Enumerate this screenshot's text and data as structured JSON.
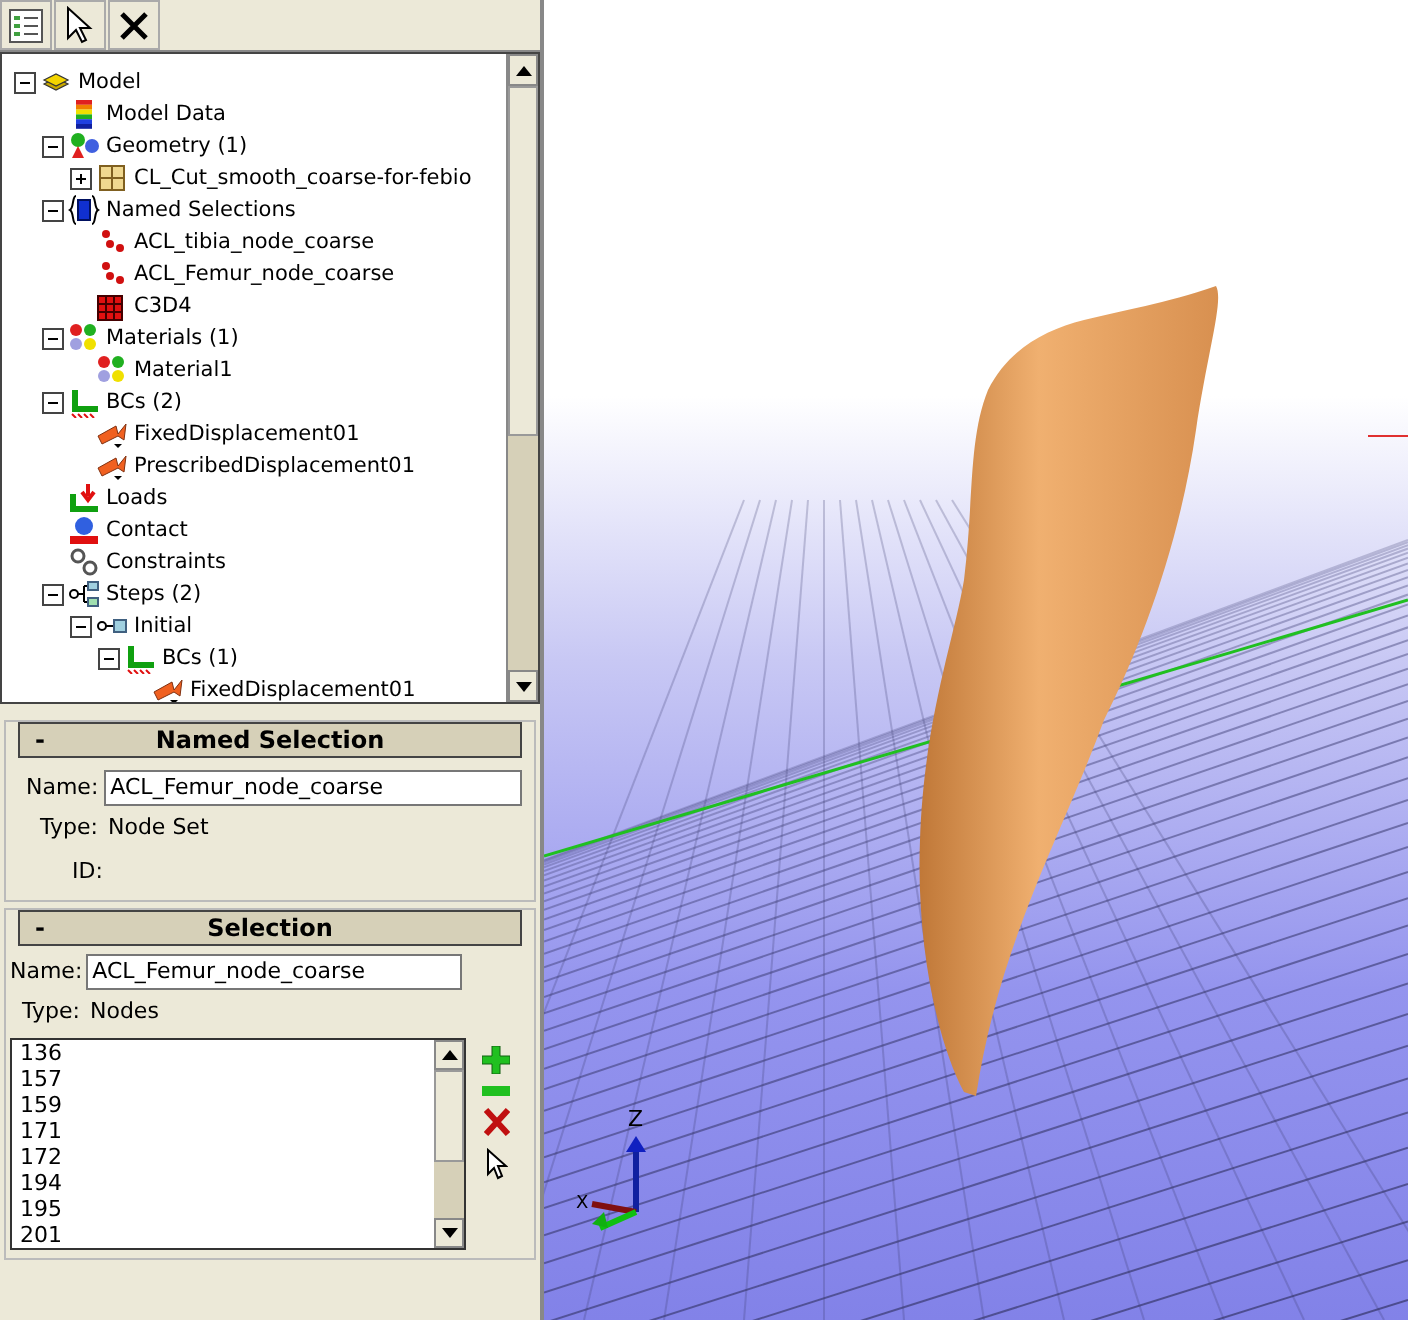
{
  "toolbar": {
    "buttons": [
      {
        "kind": "list"
      },
      {
        "kind": "pointer"
      },
      {
        "kind": "close"
      }
    ]
  },
  "tree": [
    {
      "label": "Model",
      "kind": "model",
      "expanded": true,
      "children": [
        {
          "label": "Model Data",
          "kind": "data"
        },
        {
          "label": "Geometry (1)",
          "kind": "geometry",
          "expanded": true,
          "children": [
            {
              "label": "CL_Cut_smooth_coarse-for-febio",
              "kind": "mesh",
              "expanded": false
            }
          ]
        },
        {
          "label": "Named Selections",
          "kind": "selections",
          "expanded": true,
          "children": [
            {
              "label": "ACL_tibia_node_coarse",
              "kind": "nodes"
            },
            {
              "label": "ACL_Femur_node_coarse",
              "kind": "nodes"
            },
            {
              "label": "C3D4",
              "kind": "elements"
            }
          ]
        },
        {
          "label": "Materials (1)",
          "kind": "materials",
          "expanded": true,
          "children": [
            {
              "label": "Material1",
              "kind": "materials"
            }
          ]
        },
        {
          "label": "BCs (2)",
          "kind": "bcs",
          "expanded": true,
          "children": [
            {
              "label": "FixedDisplacement01",
              "kind": "bc"
            },
            {
              "label": "PrescribedDisplacement01",
              "kind": "bc"
            }
          ]
        },
        {
          "label": "Loads",
          "kind": "loads"
        },
        {
          "label": "Contact",
          "kind": "contact"
        },
        {
          "label": "Constraints",
          "kind": "constraints"
        },
        {
          "label": "Steps (2)",
          "kind": "steps",
          "expanded": true,
          "children": [
            {
              "label": "Initial",
              "kind": "step",
              "expanded": true,
              "children": [
                {
                  "label": "BCs (1)",
                  "kind": "bcs",
                  "expanded": true,
                  "children": [
                    {
                      "label": "FixedDisplacement01",
                      "kind": "bc"
                    }
                  ]
                }
              ]
            }
          ]
        }
      ]
    }
  ],
  "named_selection": {
    "collapse_symbol": "-",
    "title": "Named Selection",
    "name_label": "Name:",
    "name_value": "ACL_Femur_node_coarse",
    "type_label": "Type:",
    "type_value": "Node Set",
    "id_label": "ID:"
  },
  "selection": {
    "collapse_symbol": "-",
    "title": "Selection",
    "name_label": "Name:",
    "name_value": "ACL_Femur_node_coarse",
    "type_label": "Type:",
    "type_value": "Nodes",
    "items": [
      "136",
      "157",
      "159",
      "171",
      "172",
      "194",
      "195",
      "201"
    ]
  },
  "viewport": {
    "axis_labels": [
      "Z",
      "X"
    ]
  }
}
